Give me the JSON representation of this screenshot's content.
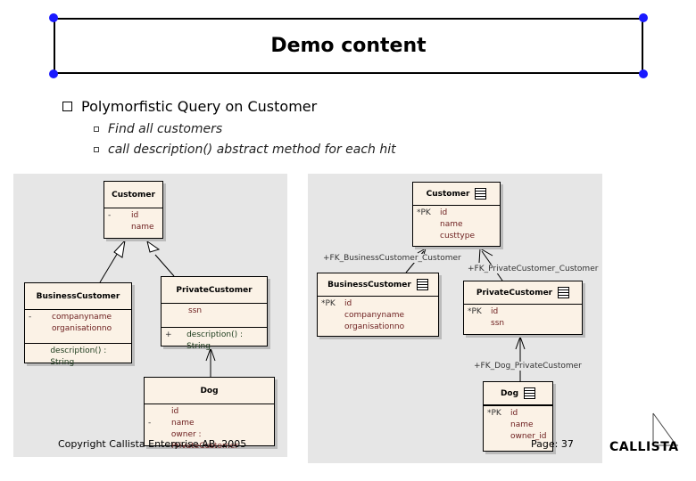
{
  "slide": {
    "title": "Demo content",
    "bullet": "Polymorfistic Query on Customer",
    "subbullets": [
      "Find all customers",
      "call description() abstract method for each hit"
    ],
    "copyright": "Copyright Callista Enterprise AB, 2005",
    "page": "Page: 37",
    "logo": "CALLISTA",
    "accent": "#1a1aff"
  },
  "uml": {
    "customer": {
      "name": "Customer",
      "attrs": [
        [
          "-",
          "id"
        ],
        [
          "",
          "name"
        ]
      ]
    },
    "business": {
      "name": "BusinessCustomer",
      "attrs": [
        [
          "-",
          "companyname"
        ],
        [
          "",
          "organisationno"
        ]
      ],
      "ops": [
        [
          "",
          "description() : String"
        ]
      ]
    },
    "private": {
      "name": "PrivateCustomer",
      "attrs": [
        [
          "",
          "ssn"
        ]
      ],
      "ops": [
        [
          "+",
          "description() : String"
        ]
      ]
    },
    "dog": {
      "name": "Dog",
      "attrs": [
        [
          "",
          "id"
        ],
        [
          "-",
          "name"
        ],
        [
          "",
          "owner : PrivateCustomer"
        ]
      ]
    }
  },
  "db": {
    "customer": {
      "name": "Customer",
      "cols": [
        [
          "*PK",
          "id"
        ],
        [
          "",
          "name"
        ],
        [
          "",
          "custtype"
        ]
      ]
    },
    "business": {
      "name": "BusinessCustomer",
      "cols": [
        [
          "*PK",
          "id"
        ],
        [
          "",
          "companyname"
        ],
        [
          "",
          "organisationno"
        ]
      ]
    },
    "private": {
      "name": "PrivateCustomer",
      "cols": [
        [
          "*PK",
          "id"
        ],
        [
          "",
          "ssn"
        ]
      ]
    },
    "dog": {
      "name": "Dog",
      "cols": [
        [
          "*PK",
          "id"
        ],
        [
          "",
          "name"
        ],
        [
          "",
          "owner_id"
        ]
      ]
    },
    "fks": [
      "+FK_BusinessCustomer_Customer",
      "+FK_PrivateCustomer_Customer",
      "+FK_Dog_PrivateCustomer"
    ]
  }
}
